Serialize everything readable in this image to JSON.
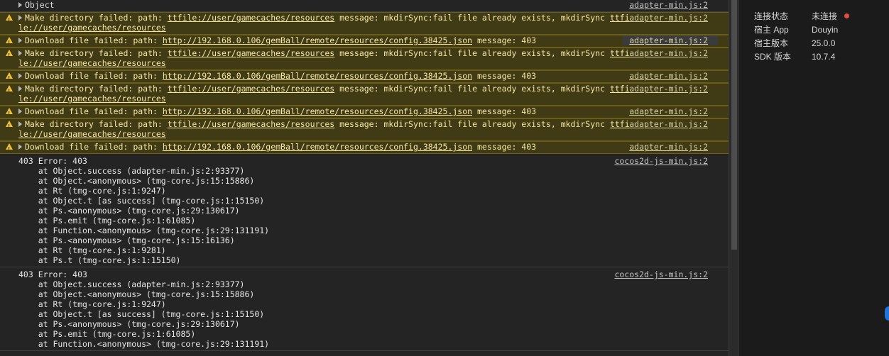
{
  "console": {
    "rows": [
      {
        "type": "info",
        "caret": true,
        "parts": [
          {
            "t": "Object"
          }
        ],
        "src": "adapter-min.js:2"
      },
      {
        "type": "warn",
        "caret": true,
        "parts": [
          {
            "t": "Make directory failed: path: "
          },
          {
            "t": "ttfile://user/gamecaches/resources",
            "link": true
          },
          {
            "t": " message: mkdirSync:fail file already exists, mkdirSync "
          },
          {
            "t": "ttfile://user/gamecaches/resources",
            "link": true
          }
        ],
        "src": "adapter-min.js:2"
      },
      {
        "type": "warn",
        "caret": true,
        "hl": true,
        "parts": [
          {
            "t": "Download file failed: path: "
          },
          {
            "t": "http://192.168.0.106/gemBall/remote/resources/config.38425.json",
            "link": true
          },
          {
            "t": " message: 403"
          }
        ],
        "src": "adapter-min.js:2"
      },
      {
        "type": "warn",
        "caret": true,
        "parts": [
          {
            "t": "Make directory failed: path: "
          },
          {
            "t": "ttfile://user/gamecaches/resources",
            "link": true
          },
          {
            "t": " message: mkdirSync:fail file already exists, mkdirSync "
          },
          {
            "t": "ttfile://user/gamecaches/resources",
            "link": true
          }
        ],
        "src": "adapter-min.js:2"
      },
      {
        "type": "warn",
        "caret": true,
        "parts": [
          {
            "t": "Download file failed: path: "
          },
          {
            "t": "http://192.168.0.106/gemBall/remote/resources/config.38425.json",
            "link": true
          },
          {
            "t": " message: 403"
          }
        ],
        "src": "adapter-min.js:2"
      },
      {
        "type": "warn",
        "caret": true,
        "parts": [
          {
            "t": "Make directory failed: path: "
          },
          {
            "t": "ttfile://user/gamecaches/resources",
            "link": true
          },
          {
            "t": " message: mkdirSync:fail file already exists, mkdirSync "
          },
          {
            "t": "ttfile://user/gamecaches/resources",
            "link": true
          }
        ],
        "src": "adapter-min.js:2"
      },
      {
        "type": "warn",
        "caret": true,
        "parts": [
          {
            "t": "Download file failed: path: "
          },
          {
            "t": "http://192.168.0.106/gemBall/remote/resources/config.38425.json",
            "link": true
          },
          {
            "t": " message: 403"
          }
        ],
        "src": "adapter-min.js:2"
      },
      {
        "type": "warn",
        "caret": true,
        "parts": [
          {
            "t": "Make directory failed: path: "
          },
          {
            "t": "ttfile://user/gamecaches/resources",
            "link": true
          },
          {
            "t": " message: mkdirSync:fail file already exists, mkdirSync "
          },
          {
            "t": "ttfile://user/gamecaches/resources",
            "link": true
          }
        ],
        "src": "adapter-min.js:2"
      },
      {
        "type": "warn",
        "caret": true,
        "parts": [
          {
            "t": "Download file failed: path: "
          },
          {
            "t": "http://192.168.0.106/gemBall/remote/resources/config.38425.json",
            "link": true
          },
          {
            "t": " message: 403"
          }
        ],
        "src": "adapter-min.js:2"
      },
      {
        "type": "err",
        "caret": false,
        "parts": [
          {
            "t": "403 Error: 403\n    at Object.success (adapter-min.js:2:93377)\n    at Object.<anonymous> (tmg-core.js:15:15886)\n    at Rt (tmg-core.js:1:9247)\n    at Object.t [as success] (tmg-core.js:1:15150)\n    at Ps.<anonymous> (tmg-core.js:29:130617)\n    at Ps.emit (tmg-core.js:1:61085)\n    at Function.<anonymous> (tmg-core.js:29:131191)\n    at Ps.<anonymous> (tmg-core.js:15:16136)\n    at Rt (tmg-core.js:1:9281)\n    at Ps.t (tmg-core.js:1:15150)"
          }
        ],
        "src": "cocos2d-js-min.js:2"
      },
      {
        "type": "err",
        "caret": false,
        "parts": [
          {
            "t": "403 Error: 403\n    at Object.success (adapter-min.js:2:93377)\n    at Object.<anonymous> (tmg-core.js:15:15886)\n    at Rt (tmg-core.js:1:9247)\n    at Object.t [as success] (tmg-core.js:1:15150)\n    at Ps.<anonymous> (tmg-core.js:29:130617)\n    at Ps.emit (tmg-core.js:1:61085)\n    at Function.<anonymous> (tmg-core.js:29:131191)"
          }
        ],
        "src": "cocos2d-js-min.js:2"
      }
    ]
  },
  "sidebar": {
    "info": [
      {
        "key": "连接状态",
        "value": "未连接",
        "status": true
      },
      {
        "key": "宿主 App",
        "value": "Douyin"
      },
      {
        "key": "宿主版本",
        "value": "25.0.0"
      },
      {
        "key": "SDK 版本",
        "value": "10.7.4"
      }
    ],
    "colors": {
      "status_dot": "#e74c3c",
      "accent": "#1e74d9",
      "warning_bg": "#413b15",
      "warning_icon": "#f1c232"
    }
  }
}
